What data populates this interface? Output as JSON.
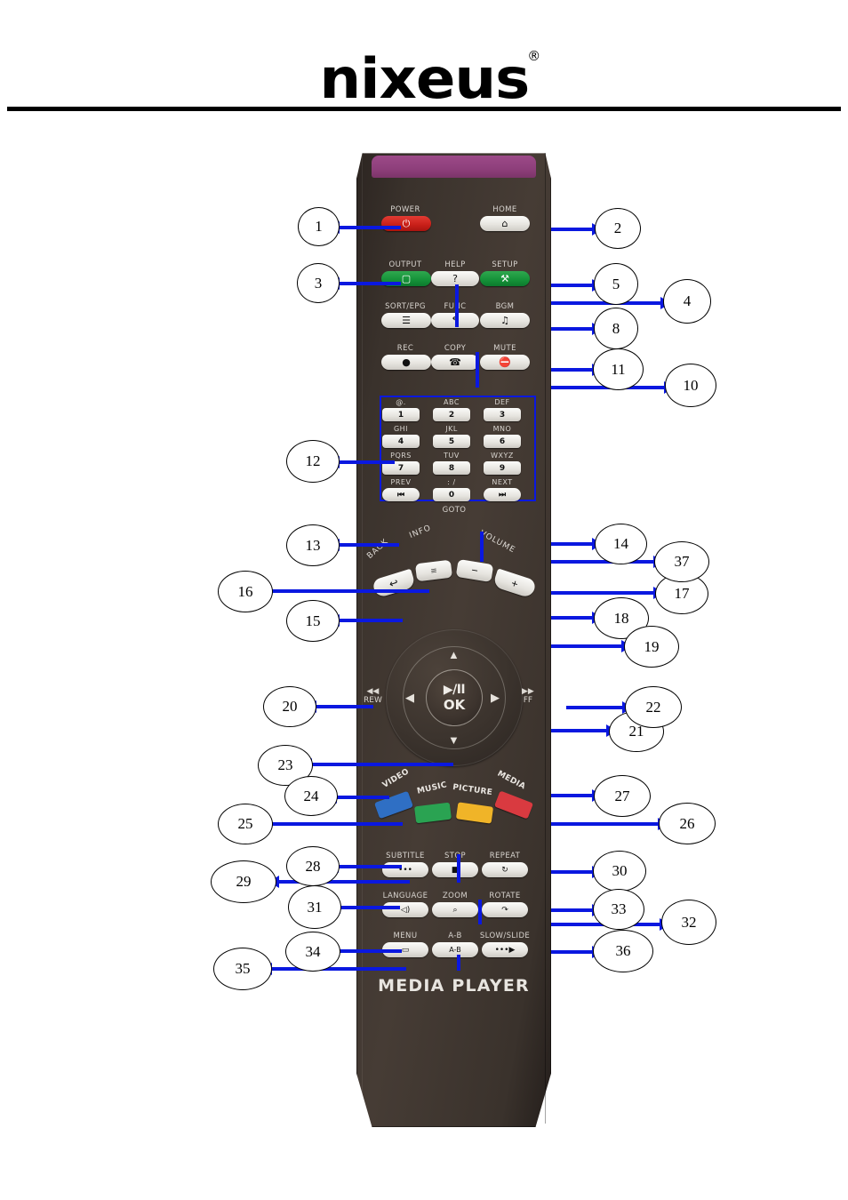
{
  "header": {
    "brand": "nixƊus",
    "brand_plain": "nixeus",
    "registered_mark": "®"
  },
  "remote": {
    "model_text": "MEDIA PLAYER",
    "ir_window_color": "#8e3f7b",
    "body_color": "#3a322c",
    "top_buttons": [
      {
        "label": "POWER",
        "glyph": "⏻",
        "color": "red",
        "name": "power-button"
      },
      {
        "label": "HOME",
        "glyph": "⌂",
        "color": "white",
        "name": "home-button"
      },
      {
        "label": "OUTPUT",
        "glyph": "▢",
        "color": "green",
        "name": "output-button"
      },
      {
        "label": "HELP",
        "glyph": "?",
        "color": "white",
        "name": "help-button"
      },
      {
        "label": "SETUP",
        "glyph": "⚒",
        "color": "green",
        "name": "setup-button"
      },
      {
        "label": "SORT/EPG",
        "glyph": "☰",
        "color": "white",
        "name": "sort-epg-button"
      },
      {
        "label": "FUNC",
        "glyph": "↰",
        "color": "white",
        "name": "func-button"
      },
      {
        "label": "BGM",
        "glyph": "♫",
        "color": "white",
        "name": "bgm-button"
      },
      {
        "label": "REC",
        "glyph": "●",
        "color": "white",
        "name": "rec-button"
      },
      {
        "label": "COPY",
        "glyph": "☎",
        "color": "white",
        "name": "copy-button"
      },
      {
        "label": "MUTE",
        "glyph": "⛔",
        "color": "white",
        "name": "mute-button"
      }
    ],
    "keypad": {
      "rows": [
        [
          {
            "digit": "1",
            "letters": "@."
          },
          {
            "digit": "2",
            "letters": "ABC"
          },
          {
            "digit": "3",
            "letters": "DEF"
          }
        ],
        [
          {
            "digit": "4",
            "letters": "GHI"
          },
          {
            "digit": "5",
            "letters": "JKL"
          },
          {
            "digit": "6",
            "letters": "MNO"
          }
        ],
        [
          {
            "digit": "7",
            "letters": "PQRS"
          },
          {
            "digit": "8",
            "letters": "TUV"
          },
          {
            "digit": "9",
            "letters": "WXYZ"
          }
        ]
      ],
      "bottom_row": [
        {
          "digit": "⏮",
          "letters": "PREV"
        },
        {
          "digit": "0",
          "letters": ": /"
        },
        {
          "digit": "⏭",
          "letters": "NEXT"
        }
      ],
      "goto_label": "GOTO"
    },
    "arc_row": {
      "back_label": "BACK",
      "info_label": "INFO",
      "volume_label": "VOLUME",
      "back_glyph": "↩",
      "info_glyph": "≡",
      "vol_down_glyph": "−",
      "vol_up_glyph": "+"
    },
    "dpad": {
      "up": "▲",
      "down": "▼",
      "left": "◀",
      "right": "▶",
      "center_play_pause": "▶/II",
      "center_ok": "OK",
      "rew_glyph": "◀◀",
      "rew_label": "REW",
      "ff_glyph": "▶▶",
      "ff_label": "FF"
    },
    "color_keys": [
      {
        "label": "VIDEO",
        "color": "#2f6fc4",
        "name": "video-color-key"
      },
      {
        "label": "MUSIC",
        "color": "#2aa352",
        "name": "music-color-key"
      },
      {
        "label": "PICTURE",
        "color": "#f0b428",
        "name": "picture-color-key"
      },
      {
        "label": "MEDIA",
        "color": "#d93a40",
        "name": "media-color-key"
      }
    ],
    "bottom_buttons": [
      {
        "label": "SUBTITLE",
        "glyph": "•••",
        "name": "subtitle-button"
      },
      {
        "label": "STOP",
        "glyph": "■",
        "name": "stop-button"
      },
      {
        "label": "REPEAT",
        "glyph": "↻",
        "name": "repeat-button"
      },
      {
        "label": "LANGUAGE",
        "glyph": "◁)",
        "name": "language-button"
      },
      {
        "label": "ZOOM",
        "glyph": "⌕",
        "name": "zoom-button"
      },
      {
        "label": "ROTATE",
        "glyph": "↷",
        "name": "rotate-button"
      },
      {
        "label": "MENU",
        "glyph": "▭",
        "name": "menu-button"
      },
      {
        "label": "A-B",
        "glyph": "A-B",
        "name": "ab-button"
      },
      {
        "label": "SLOW/SLIDE",
        "glyph": "•••▶",
        "name": "slow-slide-button"
      }
    ]
  },
  "callouts": [
    {
      "n": "1"
    },
    {
      "n": "2"
    },
    {
      "n": "3"
    },
    {
      "n": "4"
    },
    {
      "n": "5"
    },
    {
      "n": "8"
    },
    {
      "n": "10"
    },
    {
      "n": "11"
    },
    {
      "n": "12"
    },
    {
      "n": "13"
    },
    {
      "n": "14"
    },
    {
      "n": "15"
    },
    {
      "n": "16"
    },
    {
      "n": "17"
    },
    {
      "n": "18"
    },
    {
      "n": "19"
    },
    {
      "n": "20"
    },
    {
      "n": "21"
    },
    {
      "n": "22"
    },
    {
      "n": "23"
    },
    {
      "n": "24"
    },
    {
      "n": "25"
    },
    {
      "n": "26"
    },
    {
      "n": "27"
    },
    {
      "n": "28"
    },
    {
      "n": "29"
    },
    {
      "n": "30"
    },
    {
      "n": "31"
    },
    {
      "n": "32"
    },
    {
      "n": "33"
    },
    {
      "n": "34"
    },
    {
      "n": "35"
    },
    {
      "n": "36"
    },
    {
      "n": "37"
    }
  ]
}
